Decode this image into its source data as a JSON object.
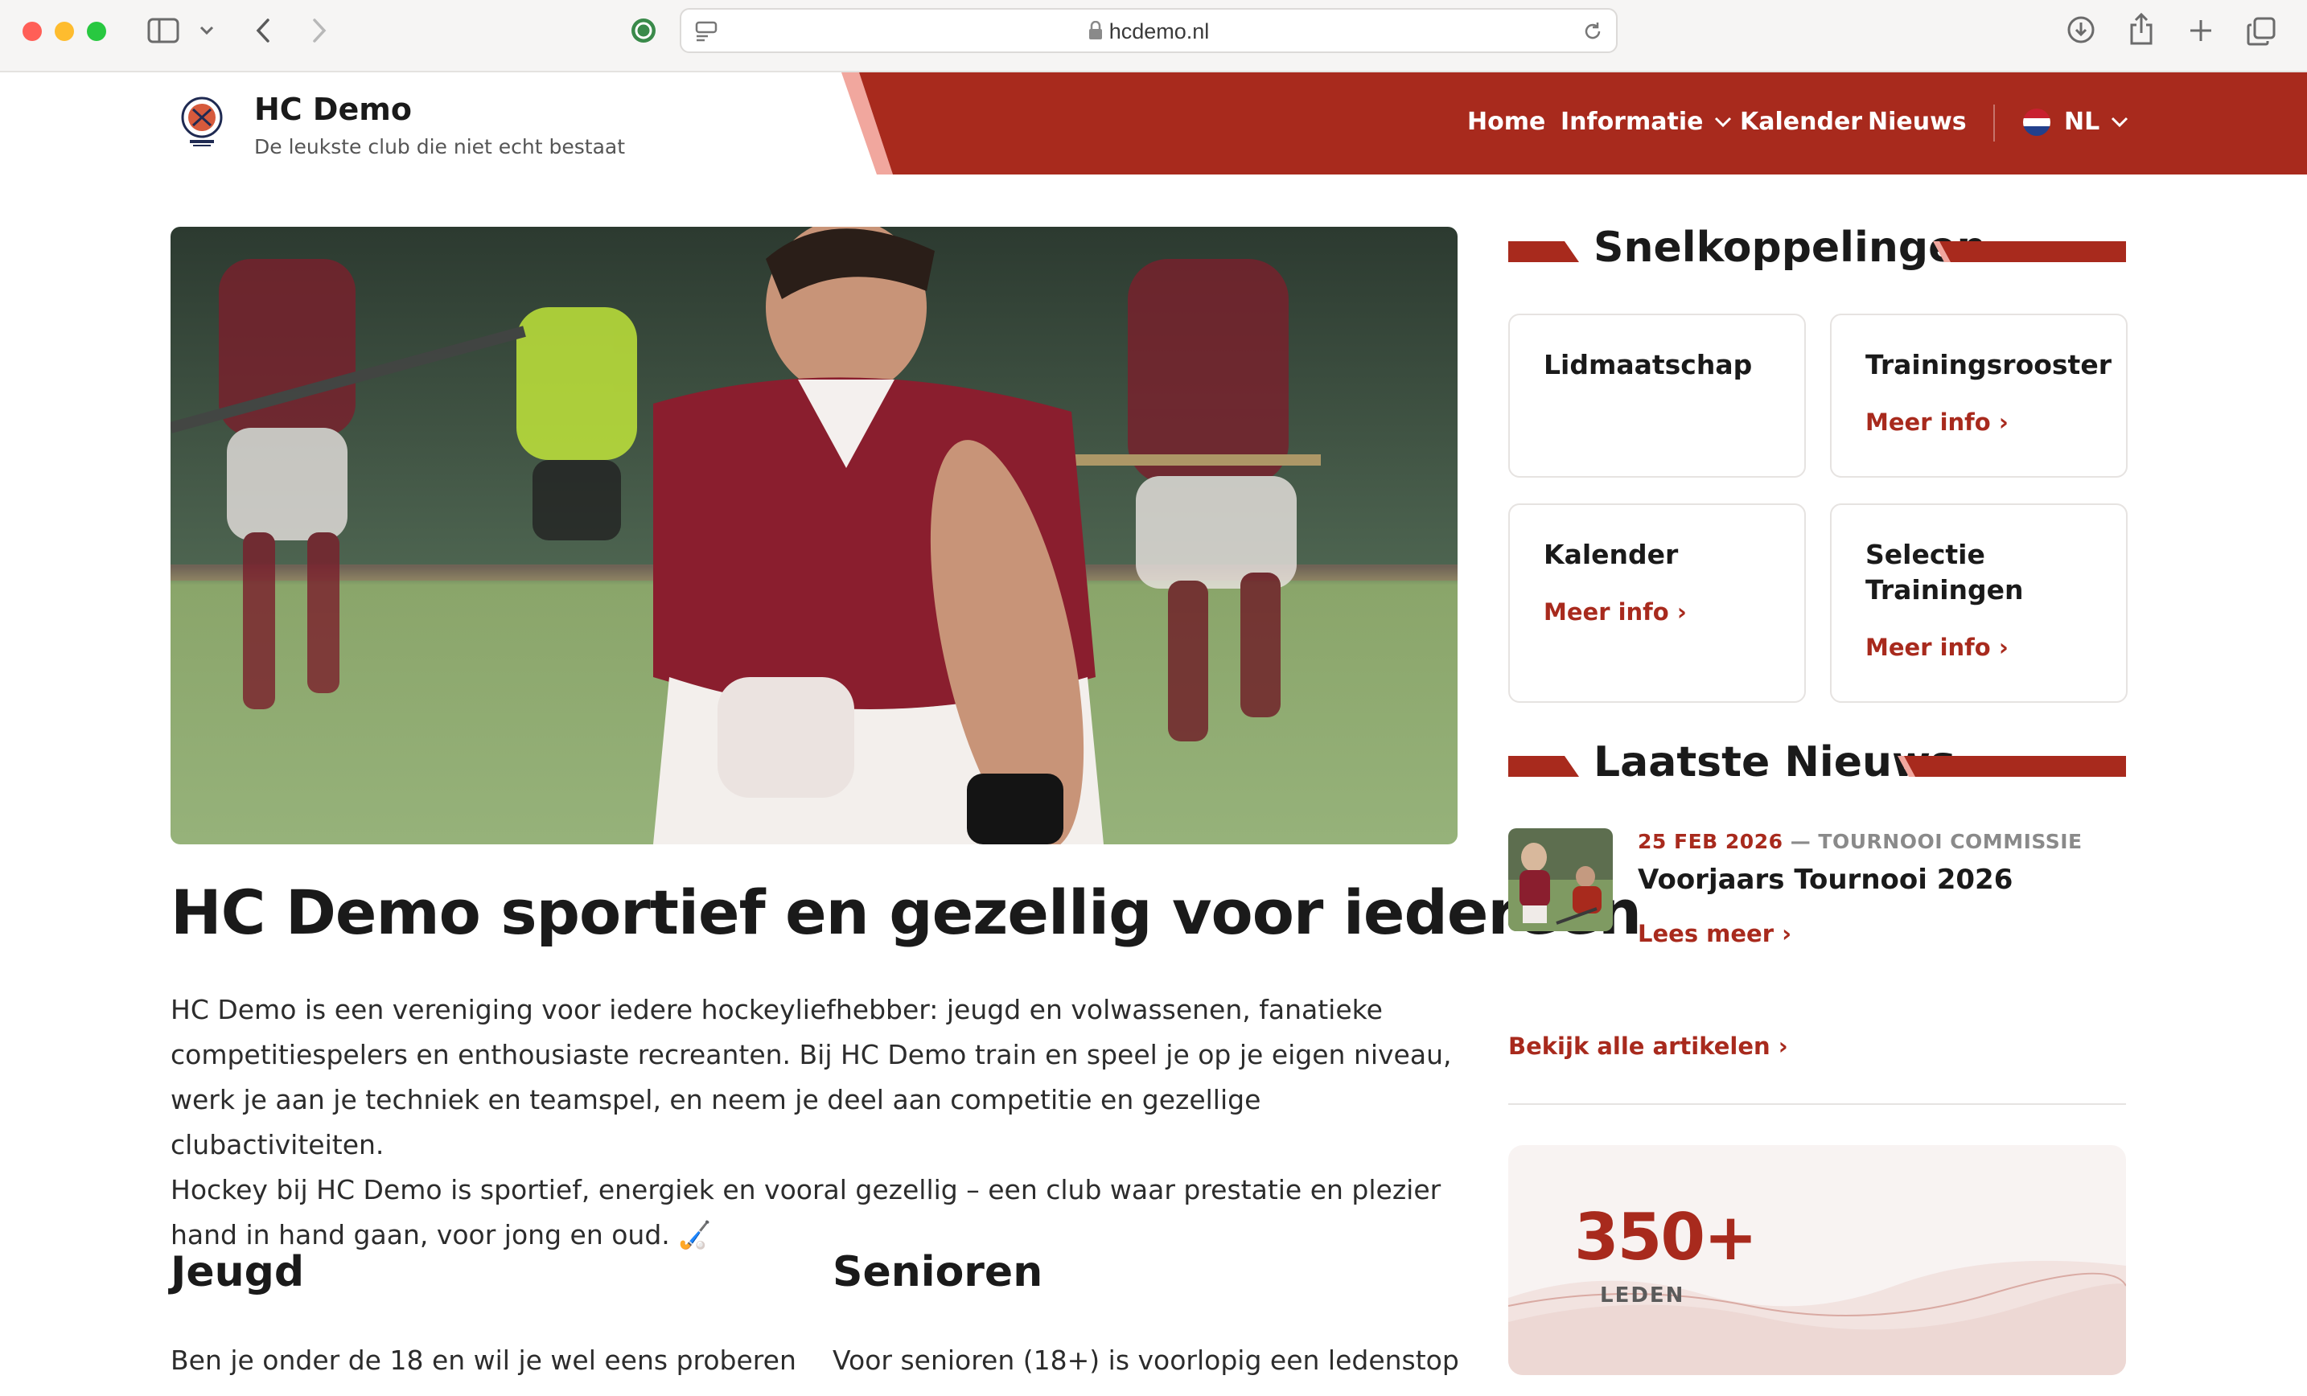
{
  "browser": {
    "url": "hcdemo.nl"
  },
  "header": {
    "title": "HC Demo",
    "tagline": "De leukste club die niet echt bestaat",
    "nav": [
      {
        "label": "Home"
      },
      {
        "label": "Informatie"
      },
      {
        "label": "Kalender"
      },
      {
        "label": "Nieuws"
      }
    ],
    "language": "NL"
  },
  "main": {
    "title": "HC Demo sportief en gezellig voor iedereen",
    "intro_lines": [
      "HC Demo is een vereniging voor iedere hockeyliefhebber: jeugd en volwassenen, fanatieke",
      "competitiespelers en enthousiaste recreanten. Bij HC Demo train en speel je op je eigen niveau,",
      "werk je aan je techniek en teamspel, en neem je deel aan competitie en gezellige clubactiviteiten.",
      "Hockey bij HC Demo is sportief, energiek en vooral gezellig – een club waar prestatie en plezier",
      "hand in hand gaan, voor jong en oud. 🏑"
    ],
    "sections": [
      {
        "heading": "Jeugd",
        "text": "Ben je onder de 18 en wil je wel eens proberen"
      },
      {
        "heading": "Senioren",
        "text": "Voor senioren (18+) is voorlopig een ledenstop"
      }
    ]
  },
  "sidebar": {
    "quicklinks_heading": "Snelkoppelingen",
    "quicklinks": [
      {
        "title": "Lidmaatschap",
        "link": ""
      },
      {
        "title": "Trainingsrooster",
        "link": "Meer info ›"
      },
      {
        "title": "Kalender",
        "link": "Meer info ›"
      },
      {
        "title": "Selectie Trainingen",
        "link": "Meer info ›"
      }
    ],
    "news_heading": "Laatste Nieuws",
    "news": [
      {
        "date": "25 FEB 2026",
        "separator": " — ",
        "category": "TOURNOOI COMMISSIE",
        "title": "Voorjaars Tournooi 2026",
        "more": "Lees meer ›"
      }
    ],
    "all_articles": "Bekijk alle artikelen ›",
    "stat": {
      "value": "350+",
      "label": "LEDEN"
    }
  },
  "colors": {
    "brand": "#a82a1d",
    "brand_accent": "#f1a79e"
  }
}
